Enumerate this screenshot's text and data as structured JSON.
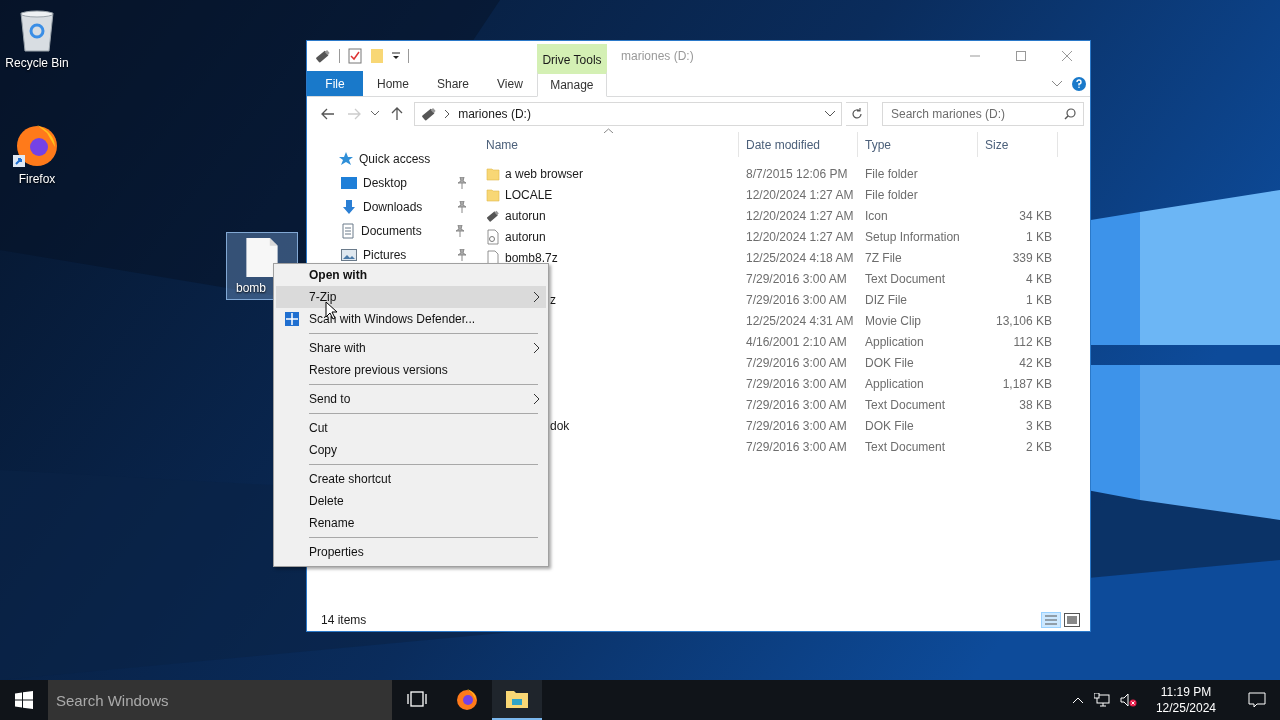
{
  "desktop_icons": [
    {
      "label": "Recycle Bin",
      "kind": "recycle",
      "selected": false
    },
    {
      "label": "Firefox",
      "kind": "firefox",
      "selected": false
    },
    {
      "label": "bomb",
      "kind": "file",
      "selected": true
    }
  ],
  "explorer": {
    "title": "mariones (D:)",
    "contextual_label": "Drive Tools",
    "tabs": [
      {
        "label": "File",
        "kind": "file",
        "selected": false
      },
      {
        "label": "Home",
        "kind": "tab",
        "selected": false
      },
      {
        "label": "Share",
        "kind": "tab",
        "selected": false
      },
      {
        "label": "View",
        "kind": "tab",
        "selected": false
      },
      {
        "label": "Manage",
        "kind": "contextual",
        "selected": true
      }
    ],
    "address": "mariones (D:)",
    "search": {
      "placeholder": "Search mariones (D:)"
    },
    "nav_header": "Quick access",
    "nav": [
      {
        "label": "Desktop",
        "kind": "desktop",
        "pinned": true
      },
      {
        "label": "Downloads",
        "kind": "downloads",
        "pinned": true
      },
      {
        "label": "Documents",
        "kind": "documents",
        "pinned": true
      },
      {
        "label": "Pictures",
        "kind": "pictures",
        "pinned": true
      }
    ],
    "columns": [
      "Name",
      "Date modified",
      "Type",
      "Size"
    ],
    "rows": [
      {
        "kind": "folder",
        "name": "a web browser",
        "date": "8/7/2015 12:06 PM",
        "type": "File folder"
      },
      {
        "kind": "folder",
        "name": "LOCALE",
        "date": "12/20/2024 1:27 AM",
        "type": "File folder"
      },
      {
        "kind": "drive",
        "name": "autorun",
        "date": "12/20/2024 1:27 AM",
        "type": "Icon",
        "size": "34 KB"
      },
      {
        "kind": "setup",
        "name": "autorun",
        "date": "12/20/2024 1:27 AM",
        "type": "Setup Information",
        "size": "1 KB"
      },
      {
        "kind": "file",
        "name": "bomb8.7z",
        "date": "12/25/2024 4:18 AM",
        "type": "7Z File",
        "size": "339 KB"
      },
      {
        "kind": "covered",
        "date": "7/29/2016 3:00 AM",
        "type": "Text Document",
        "size": "4 KB"
      },
      {
        "kind": "covered",
        "name": "z",
        "date": "7/29/2016 3:00 AM",
        "type": "DIZ File",
        "size": "1 KB"
      },
      {
        "kind": "covered",
        "date": "12/25/2024 4:31 AM",
        "type": "Movie Clip",
        "size": "13,106 KB"
      },
      {
        "kind": "covered",
        "date": "4/16/2001 2:10 AM",
        "type": "Application",
        "size": "112 KB"
      },
      {
        "kind": "covered",
        "date": "7/29/2016 3:00 AM",
        "type": "DOK File",
        "size": "42 KB"
      },
      {
        "kind": "covered",
        "date": "7/29/2016 3:00 AM",
        "type": "Application",
        "size": "1,187 KB"
      },
      {
        "kind": "covered",
        "date": "7/29/2016 3:00 AM",
        "type": "Text Document",
        "size": "38 KB"
      },
      {
        "kind": "covered",
        "name": "dok",
        "date": "7/29/2016 3:00 AM",
        "type": "DOK File",
        "size": "3 KB"
      },
      {
        "kind": "covered",
        "date": "7/29/2016 3:00 AM",
        "type": "Text Document",
        "size": "2 KB"
      }
    ],
    "status": "14 items"
  },
  "context_menu": [
    {
      "kind": "item",
      "label": "Open with",
      "default": true,
      "selected": false,
      "submenu": false,
      "icon": false
    },
    {
      "kind": "item",
      "label": "7-Zip",
      "default": false,
      "selected": true,
      "submenu": true,
      "icon": false
    },
    {
      "kind": "item",
      "label": "Scan with Windows Defender...",
      "default": false,
      "selected": false,
      "submenu": false,
      "icon": true
    },
    {
      "kind": "separator"
    },
    {
      "kind": "item",
      "label": "Share with",
      "default": false,
      "selected": false,
      "submenu": true,
      "icon": false
    },
    {
      "kind": "item",
      "label": "Restore previous versions",
      "default": false,
      "selected": false,
      "submenu": false,
      "icon": false
    },
    {
      "kind": "separator"
    },
    {
      "kind": "item",
      "label": "Send to",
      "default": false,
      "selected": false,
      "submenu": true,
      "icon": false
    },
    {
      "kind": "separator"
    },
    {
      "kind": "item",
      "label": "Cut",
      "default": false,
      "selected": false,
      "submenu": false,
      "icon": false
    },
    {
      "kind": "item",
      "label": "Copy",
      "default": false,
      "selected": false,
      "submenu": false,
      "icon": false
    },
    {
      "kind": "separator"
    },
    {
      "kind": "item",
      "label": "Create shortcut",
      "default": false,
      "selected": false,
      "submenu": false,
      "icon": false
    },
    {
      "kind": "item",
      "label": "Delete",
      "default": false,
      "selected": false,
      "submenu": false,
      "icon": false
    },
    {
      "kind": "item",
      "label": "Rename",
      "default": false,
      "selected": false,
      "submenu": false,
      "icon": false
    },
    {
      "kind": "separator"
    },
    {
      "kind": "item",
      "label": "Properties",
      "default": false,
      "selected": false,
      "submenu": false,
      "icon": false
    }
  ],
  "taskbar": {
    "search": {
      "placeholder": "Search Windows"
    },
    "apps": [
      {
        "kind": "taskview",
        "selected": false
      },
      {
        "kind": "firefox",
        "selected": false
      },
      {
        "kind": "explorer",
        "selected": true
      }
    ],
    "time": "11:19 PM",
    "date": "12/25/2024"
  }
}
